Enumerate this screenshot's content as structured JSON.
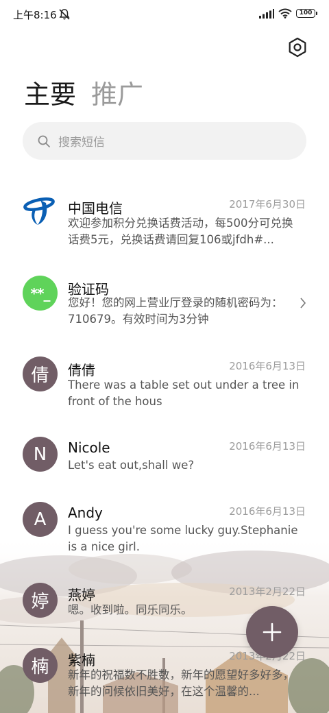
{
  "status_bar": {
    "time": "上午8:16",
    "battery": "100"
  },
  "tabs": [
    {
      "label": "主要",
      "active": true
    },
    {
      "label": "推广",
      "active": false
    }
  ],
  "search": {
    "placeholder": "搜索短信"
  },
  "messages": [
    {
      "avatar_icon": "china-telecom-logo",
      "name": "中国电信",
      "date": "2017年6月30日",
      "preview": "欢迎参加积分兑换话费活动，每500分可兑换话费5元，兑换话费请回复106或jfdh#..."
    },
    {
      "avatar_text": "**_",
      "name": "验证码",
      "date": "",
      "preview": "您好！您的网上营业厅登录的随机密码为：710679。有效时间为3分钟"
    },
    {
      "avatar_text": "倩",
      "name": "倩倩",
      "date": "2016年6月13日",
      "preview": "There was a table set out under a tree in front of the hous"
    },
    {
      "avatar_text": "N",
      "name": "Nicole",
      "date": "2016年6月13日",
      "preview": "Let's eat out,shall we?"
    },
    {
      "avatar_text": "A",
      "name": "Andy",
      "date": "2016年6月13日",
      "preview": "I guess you're some lucky guy.Stephanie is a nice girl."
    },
    {
      "avatar_text": "婷",
      "name": "燕婷",
      "date": "2013年2月22日",
      "preview": "嗯。收到啦。同乐同乐。"
    },
    {
      "avatar_text": "楠",
      "name": "紫楠",
      "date": "2013年2月22日",
      "preview": "新年的祝福数不胜数，新年的愿望好多好多，新年的问候依旧美好，在这个温馨的..."
    }
  ],
  "colors": {
    "avatar": "#715d66",
    "verify_avatar": "#5fd35a",
    "telecom_blue": "#0a5fb4"
  }
}
